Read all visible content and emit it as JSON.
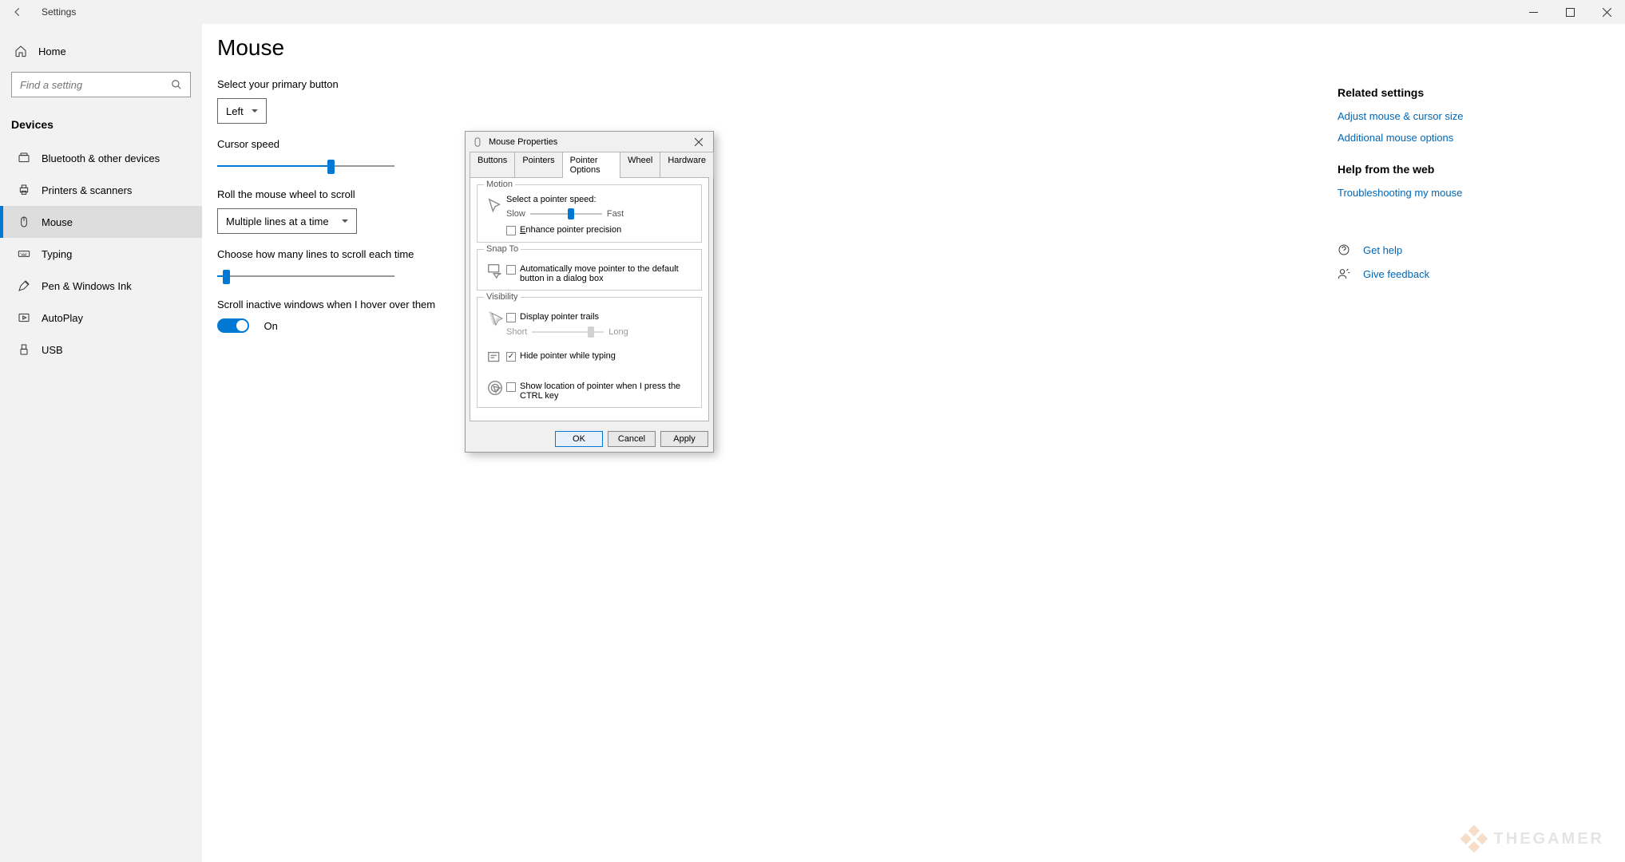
{
  "app": {
    "title": "Settings"
  },
  "sidebar": {
    "home": "Home",
    "search_placeholder": "Find a setting",
    "category": "Devices",
    "items": [
      {
        "label": "Bluetooth & other devices"
      },
      {
        "label": "Printers & scanners"
      },
      {
        "label": "Mouse"
      },
      {
        "label": "Typing"
      },
      {
        "label": "Pen & Windows Ink"
      },
      {
        "label": "AutoPlay"
      },
      {
        "label": "USB"
      }
    ]
  },
  "main": {
    "title": "Mouse",
    "primary_label": "Select your primary button",
    "primary_value": "Left",
    "cursor_speed_label": "Cursor speed",
    "roll_label": "Roll the mouse wheel to scroll",
    "roll_value": "Multiple lines at a time",
    "lines_label": "Choose how many lines to scroll each time",
    "scroll_inactive_label": "Scroll inactive windows when I hover over them",
    "scroll_inactive_value": "On"
  },
  "rail": {
    "related_hdr": "Related settings",
    "link1": "Adjust mouse & cursor size",
    "link2": "Additional mouse options",
    "help_hdr": "Help from the web",
    "link3": "Troubleshooting my mouse",
    "get_help": "Get help",
    "feedback": "Give feedback"
  },
  "dialog": {
    "title": "Mouse Properties",
    "tabs": [
      "Buttons",
      "Pointers",
      "Pointer Options",
      "Wheel",
      "Hardware"
    ],
    "motion": {
      "title": "Motion",
      "speed_label": "Select a pointer speed:",
      "slow": "Slow",
      "fast": "Fast",
      "enhance": "Enhance pointer precision"
    },
    "snap": {
      "title": "Snap To",
      "label": "Automatically move pointer to the default button in a dialog box"
    },
    "vis": {
      "title": "Visibility",
      "trails": "Display pointer trails",
      "short": "Short",
      "long": "Long",
      "hide": "Hide pointer while typing",
      "ctrl": "Show location of pointer when I press the CTRL key"
    },
    "ok": "OK",
    "cancel": "Cancel",
    "apply": "Apply"
  },
  "watermark": "THEGAMER"
}
